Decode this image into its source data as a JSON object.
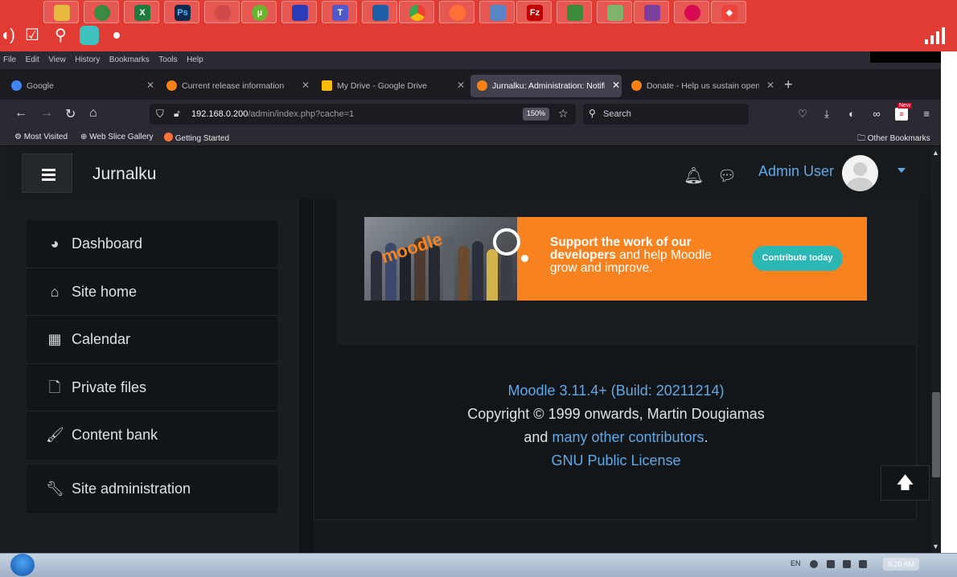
{
  "browser": {
    "menu": [
      "File",
      "Edit",
      "View",
      "History",
      "Bookmarks",
      "Tools",
      "Help"
    ],
    "tabs": [
      {
        "label": "Google",
        "active": false,
        "color": "#4285f4"
      },
      {
        "label": "Current release information",
        "active": false,
        "color": "#f98012"
      },
      {
        "label": "My Drive - Google Drive",
        "active": false,
        "color": "#fbbc04"
      },
      {
        "label": "Jurnalku: Administration: Notifi",
        "active": true,
        "color": "#f98012"
      },
      {
        "label": "Donate - Help us sustain open",
        "active": false,
        "color": "#f98012"
      }
    ],
    "url_host": "192.168.0.200",
    "url_path": "/admin/index.php?cache=1",
    "zoom": "150%",
    "search_placeholder": "Search",
    "bookmarks": [
      "Most Visited",
      "Web Slice Gallery",
      "Getting Started"
    ],
    "other_bookmarks": "Other Bookmarks",
    "new_badge": "New"
  },
  "site": {
    "name": "Jurnalku",
    "user": "Admin User"
  },
  "nav": {
    "items": [
      {
        "label": "Dashboard",
        "icon": "dashboard-icon"
      },
      {
        "label": "Site home",
        "icon": "home-icon"
      },
      {
        "label": "Calendar",
        "icon": "calendar-icon"
      },
      {
        "label": "Private files",
        "icon": "file-icon"
      },
      {
        "label": "Content bank",
        "icon": "brush-icon"
      }
    ],
    "admin": {
      "label": "Site administration",
      "icon": "wrench-icon"
    }
  },
  "banner": {
    "text_bold_1": "Support the work of our",
    "text_bold_2": "developers",
    "text_rest": "and help Moodle",
    "text_line3": "grow and improve.",
    "button": "Contribute today"
  },
  "footer": {
    "version": "Moodle 3.11.4+ (Build: 20211214)",
    "copyright": "Copyright © 1999 onwards, Martin Dougiamas",
    "and": "and",
    "contributors": "many other contributors",
    "period": ".",
    "license": "GNU Public License"
  },
  "taskbar": {
    "lang": "EN",
    "time": "9:20 AM"
  },
  "colors": {
    "remote_bar": "#e23b33",
    "link": "#5ea9e8",
    "banner": "#f7821f",
    "banner_button": "#2bb7b3"
  }
}
